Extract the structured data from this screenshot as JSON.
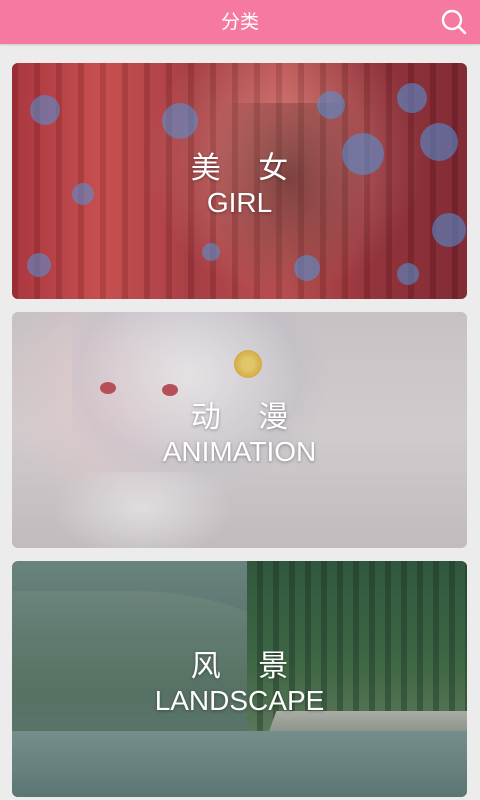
{
  "header": {
    "title": "分类",
    "search_icon": "search-icon",
    "color": "#f67aa0"
  },
  "categories": [
    {
      "cn": "美 女",
      "en": "GIRL"
    },
    {
      "cn": "动 漫",
      "en": "ANIMATION"
    },
    {
      "cn": "风 景",
      "en": "LANDSCAPE"
    }
  ]
}
